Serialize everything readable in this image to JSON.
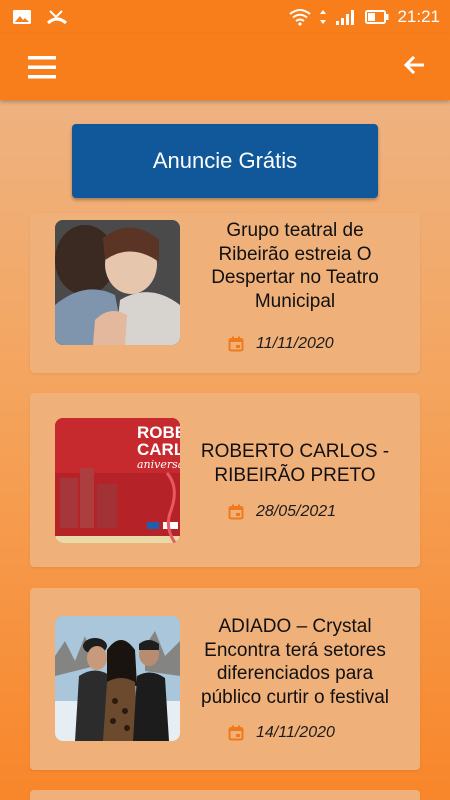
{
  "status_bar": {
    "time": "21:21"
  },
  "header": {
    "menu_icon": "menu-icon",
    "back_icon": "back-arrow-icon"
  },
  "ad_button": {
    "label": "Anuncie Grátis"
  },
  "news": [
    {
      "title": "Grupo teatral de Ribeirão estreia O Despertar no Teatro Municipal",
      "date": "11/11/2020"
    },
    {
      "title": "ROBERTO CARLOS - RIBEIRÃO PRETO",
      "date": "28/05/2021",
      "thumb_text_1": "ROBERTO",
      "thumb_text_2": "CARLO",
      "thumb_text_3": "aniversá"
    },
    {
      "title": "ADIADO – Crystal Encontra terá setores diferenciados para público curtir o festival",
      "date": "14/11/2020"
    }
  ],
  "colors": {
    "accent": "#f87e1c",
    "button": "#11589a",
    "card": "#efb07a",
    "date_icon": "#f07a1a"
  }
}
